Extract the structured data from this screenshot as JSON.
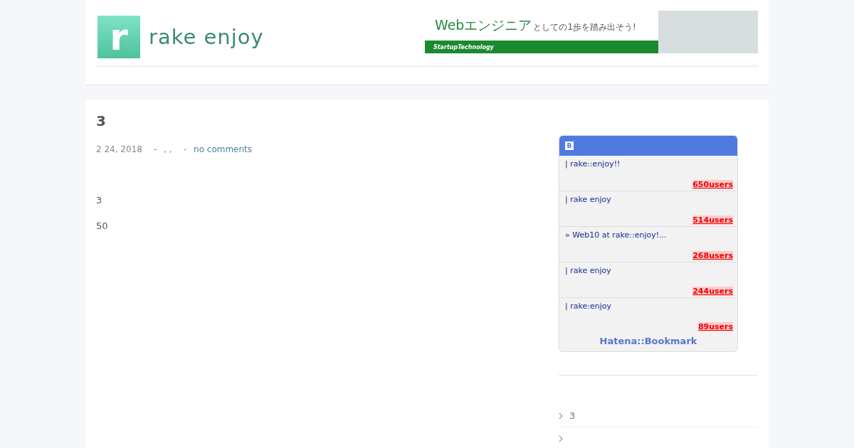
{
  "header": {
    "logo_letter": "r",
    "site_name": "rake enjoy",
    "banner": {
      "headline": "Webエンジニア",
      "headline_small": "としての1歩を踏み出そう!",
      "brand": "StartupTechnology"
    }
  },
  "post": {
    "title": "3",
    "date": "2 24, 2018",
    "separator_1": "-",
    "categories": ", ,",
    "separator_2": "-",
    "comments_link": "no comments",
    "paragraphs": [
      "3",
      "50"
    ]
  },
  "sidebar": {
    "bookmark_widget": {
      "badge": "B",
      "entries": [
        {
          "title": "| rake::enjoy!!",
          "users": "650users"
        },
        {
          "title": "| rake enjoy",
          "users": "514users"
        },
        {
          "title": "» Web10 at rake::enjoy!...",
          "users": "268users"
        },
        {
          "title": "| rake enjoy",
          "users": "244users"
        },
        {
          "title": "| rake:enjoy",
          "users": "89users"
        }
      ],
      "footer": "Hatena::Bookmark"
    },
    "links": [
      {
        "kind": "labeled",
        "label": "3"
      },
      {
        "kind": "blank"
      }
    ]
  }
}
